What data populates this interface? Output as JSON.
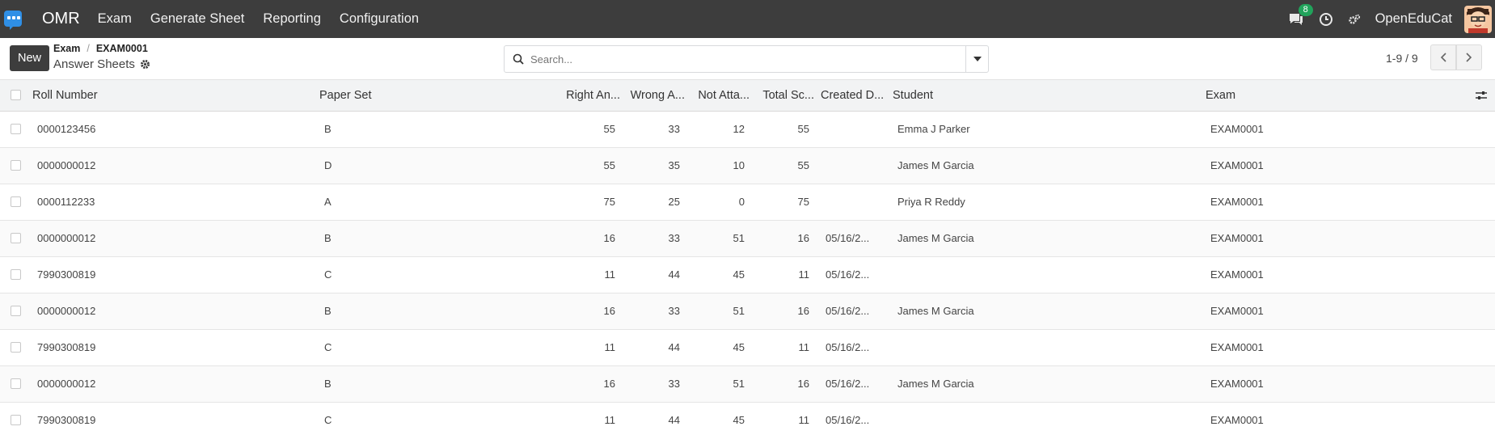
{
  "navbar": {
    "brand": "OMR",
    "menu": [
      "Exam",
      "Generate Sheet",
      "Reporting",
      "Configuration"
    ],
    "messages_count": "8",
    "company": "OpenEduCat"
  },
  "control": {
    "new_label": "New",
    "breadcrumb": [
      "Exam",
      "EXAM0001"
    ],
    "current": "Answer Sheets",
    "search_placeholder": "Search...",
    "pager": "1-9 / 9"
  },
  "table": {
    "headers": [
      "Roll Number",
      "Paper Set",
      "Right An...",
      "Wrong A...",
      "Not Atta...",
      "Total Sc...",
      "Created D...",
      "Student",
      "Exam"
    ],
    "rows": [
      [
        "0000123456",
        "B",
        "55",
        "33",
        "12",
        "55",
        "",
        "Emma J Parker",
        "EXAM0001"
      ],
      [
        "0000000012",
        "D",
        "55",
        "35",
        "10",
        "55",
        "",
        "James M Garcia",
        "EXAM0001"
      ],
      [
        "0000112233",
        "A",
        "75",
        "25",
        "0",
        "75",
        "",
        "Priya R Reddy",
        "EXAM0001"
      ],
      [
        "0000000012",
        "B",
        "16",
        "33",
        "51",
        "16",
        "05/16/2...",
        "James M Garcia",
        "EXAM0001"
      ],
      [
        "7990300819",
        "C",
        "11",
        "44",
        "45",
        "11",
        "05/16/2...",
        "",
        "EXAM0001"
      ],
      [
        "0000000012",
        "B",
        "16",
        "33",
        "51",
        "16",
        "05/16/2...",
        "James M Garcia",
        "EXAM0001"
      ],
      [
        "7990300819",
        "C",
        "11",
        "44",
        "45",
        "11",
        "05/16/2...",
        "",
        "EXAM0001"
      ],
      [
        "0000000012",
        "B",
        "16",
        "33",
        "51",
        "16",
        "05/16/2...",
        "James M Garcia",
        "EXAM0001"
      ],
      [
        "7990300819",
        "C",
        "11",
        "44",
        "45",
        "11",
        "05/16/2...",
        "",
        "EXAM0001"
      ]
    ]
  }
}
